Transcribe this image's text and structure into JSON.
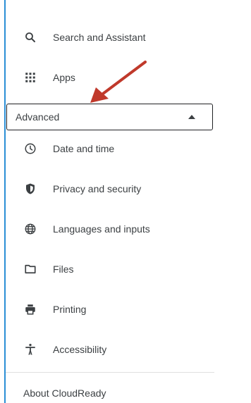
{
  "menu_top": [
    {
      "label": "Search and Assistant",
      "icon": "search-icon"
    },
    {
      "label": "Apps",
      "icon": "apps-grid-icon"
    }
  ],
  "advanced": {
    "label": "Advanced",
    "expanded": true
  },
  "advanced_items": [
    {
      "label": "Date and time",
      "icon": "clock-icon"
    },
    {
      "label": "Privacy and security",
      "icon": "shield-icon"
    },
    {
      "label": "Languages and inputs",
      "icon": "globe-icon"
    },
    {
      "label": "Files",
      "icon": "folder-icon"
    },
    {
      "label": "Printing",
      "icon": "printer-icon"
    },
    {
      "label": "Accessibility",
      "icon": "accessibility-icon"
    }
  ],
  "about": {
    "label": "About CloudReady"
  },
  "colors": {
    "accent_rule": "#2b8fd6",
    "annotation_arrow": "#c0392b",
    "text": "#3c4043"
  }
}
